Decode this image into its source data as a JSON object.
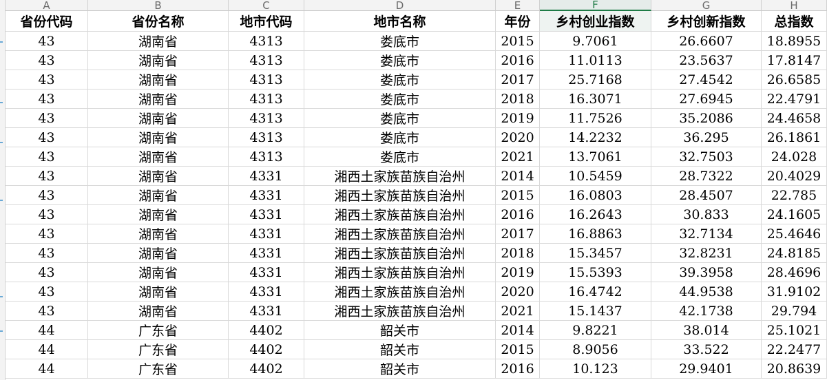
{
  "column_letters": [
    "A",
    "B",
    "C",
    "D",
    "E",
    "F",
    "G",
    "H"
  ],
  "active_column": "F",
  "headers": [
    "省份代码",
    "省份名称",
    "地市代码",
    "地市名称",
    "年份",
    "乡村创业指数",
    "乡村创新指数",
    "总指数"
  ],
  "rows": [
    [
      "43",
      "湖南省",
      "4313",
      "娄底市",
      "2015",
      "9.7061",
      "26.6607",
      "18.8955"
    ],
    [
      "43",
      "湖南省",
      "4313",
      "娄底市",
      "2016",
      "11.0113",
      "23.5637",
      "17.8147"
    ],
    [
      "43",
      "湖南省",
      "4313",
      "娄底市",
      "2017",
      "25.7168",
      "27.4542",
      "26.6585"
    ],
    [
      "43",
      "湖南省",
      "4313",
      "娄底市",
      "2018",
      "16.3071",
      "27.6945",
      "22.4791"
    ],
    [
      "43",
      "湖南省",
      "4313",
      "娄底市",
      "2019",
      "11.7526",
      "35.2086",
      "24.4658"
    ],
    [
      "43",
      "湖南省",
      "4313",
      "娄底市",
      "2020",
      "14.2232",
      "36.295",
      "26.1861"
    ],
    [
      "43",
      "湖南省",
      "4313",
      "娄底市",
      "2021",
      "13.7061",
      "32.7503",
      "24.028"
    ],
    [
      "43",
      "湖南省",
      "4331",
      "湘西土家族苗族自治州",
      "2014",
      "10.5459",
      "28.7322",
      "20.4029"
    ],
    [
      "43",
      "湖南省",
      "4331",
      "湘西土家族苗族自治州",
      "2015",
      "16.0803",
      "28.4507",
      "22.785"
    ],
    [
      "43",
      "湖南省",
      "4331",
      "湘西土家族苗族自治州",
      "2016",
      "16.2643",
      "30.833",
      "24.1605"
    ],
    [
      "43",
      "湖南省",
      "4331",
      "湘西土家族苗族自治州",
      "2017",
      "16.8863",
      "32.7134",
      "25.4646"
    ],
    [
      "43",
      "湖南省",
      "4331",
      "湘西土家族苗族自治州",
      "2018",
      "15.3457",
      "32.8231",
      "24.8185"
    ],
    [
      "43",
      "湖南省",
      "4331",
      "湘西土家族苗族自治州",
      "2019",
      "15.5393",
      "39.3958",
      "28.4696"
    ],
    [
      "43",
      "湖南省",
      "4331",
      "湘西土家族苗族自治州",
      "2020",
      "16.4742",
      "44.9538",
      "31.9102"
    ],
    [
      "43",
      "湖南省",
      "4331",
      "湘西土家族苗族自治州",
      "2021",
      "15.1437",
      "42.1738",
      "29.794"
    ],
    [
      "44",
      "广东省",
      "4402",
      "韶关市",
      "2014",
      "9.8221",
      "38.014",
      "25.1021"
    ],
    [
      "44",
      "广东省",
      "4402",
      "韶关市",
      "2015",
      "8.9056",
      "33.522",
      "22.2477"
    ],
    [
      "44",
      "广东省",
      "4402",
      "韶关市",
      "2016",
      "10.123",
      "29.9401",
      "20.8639"
    ]
  ]
}
